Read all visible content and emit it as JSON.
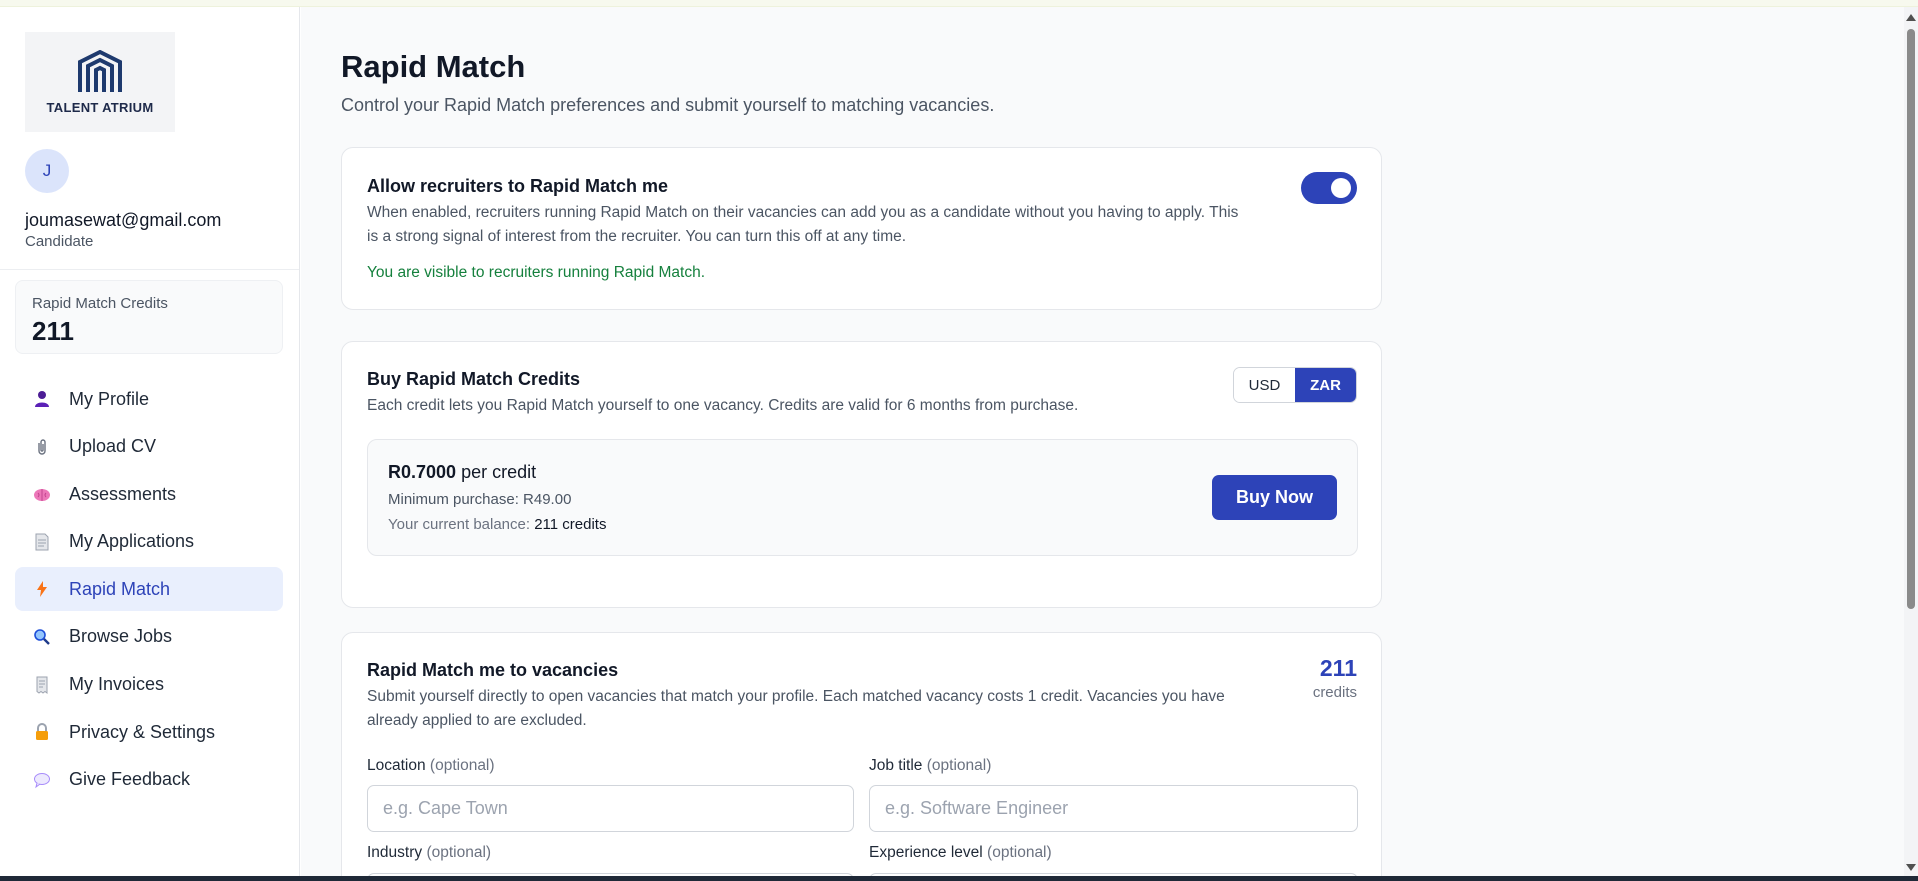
{
  "brand": {
    "name": "TALENT ATRIUM"
  },
  "user": {
    "initial": "J",
    "email": "joumasewat@gmail.com",
    "role": "Candidate"
  },
  "sidebar_credits": {
    "label": "Rapid Match Credits",
    "value": "211"
  },
  "nav": [
    {
      "label": "My Profile",
      "icon": "user-icon",
      "active": false
    },
    {
      "label": "Upload CV",
      "icon": "paperclip-icon",
      "active": false
    },
    {
      "label": "Assessments",
      "icon": "brain-icon",
      "active": false
    },
    {
      "label": "My Applications",
      "icon": "document-icon",
      "active": false
    },
    {
      "label": "Rapid Match",
      "icon": "lightning-icon",
      "active": true
    },
    {
      "label": "Browse Jobs",
      "icon": "magnifier-icon",
      "active": false
    },
    {
      "label": "My Invoices",
      "icon": "receipt-icon",
      "active": false
    },
    {
      "label": "Privacy & Settings",
      "icon": "lock-icon",
      "active": false
    },
    {
      "label": "Give Feedback",
      "icon": "speech-bubble-icon",
      "active": false
    }
  ],
  "page": {
    "title": "Rapid Match",
    "subtitle": "Control your Rapid Match preferences and submit yourself to matching vacancies."
  },
  "allow_card": {
    "title": "Allow recruiters to Rapid Match me",
    "desc_line1": "When enabled, recruiters running Rapid Match on their vacancies can add you as a candidate without you having to apply. This",
    "desc_line2": "is a strong signal of interest from the recruiter. You can turn this off at any time.",
    "status": "You are visible to recruiters running Rapid Match.",
    "toggle_on": true
  },
  "buy_card": {
    "title": "Buy Rapid Match Credits",
    "desc": "Each credit lets you Rapid Match yourself to one vacancy. Credits are valid for 6 months from purchase.",
    "currencies": [
      "USD",
      "ZAR"
    ],
    "selected_currency": "ZAR",
    "price": "R0.7000",
    "price_suffix": " per credit",
    "minimum": "Minimum purchase: R49.00",
    "balance_label": "Your current balance: ",
    "balance_value": "211 credits",
    "buy_label": "Buy Now"
  },
  "match_card": {
    "title": "Rapid Match me to vacancies",
    "desc_line1": "Submit yourself directly to open vacancies that match your profile. Each matched vacancy costs 1 credit. Vacancies you have",
    "desc_line2": "already applied to are excluded.",
    "credits_value": "211",
    "credits_label": "credits",
    "optional": "(optional)",
    "fields": {
      "location": {
        "label": "Location",
        "placeholder": "e.g. Cape Town"
      },
      "job_title": {
        "label": "Job title",
        "placeholder": "e.g. Software Engineer"
      },
      "industry": {
        "label": "Industry"
      },
      "experience": {
        "label": "Experience level"
      }
    }
  },
  "colors": {
    "accent": "#2d43b8",
    "success": "#15803d",
    "active_nav_bg": "#e9effd"
  }
}
